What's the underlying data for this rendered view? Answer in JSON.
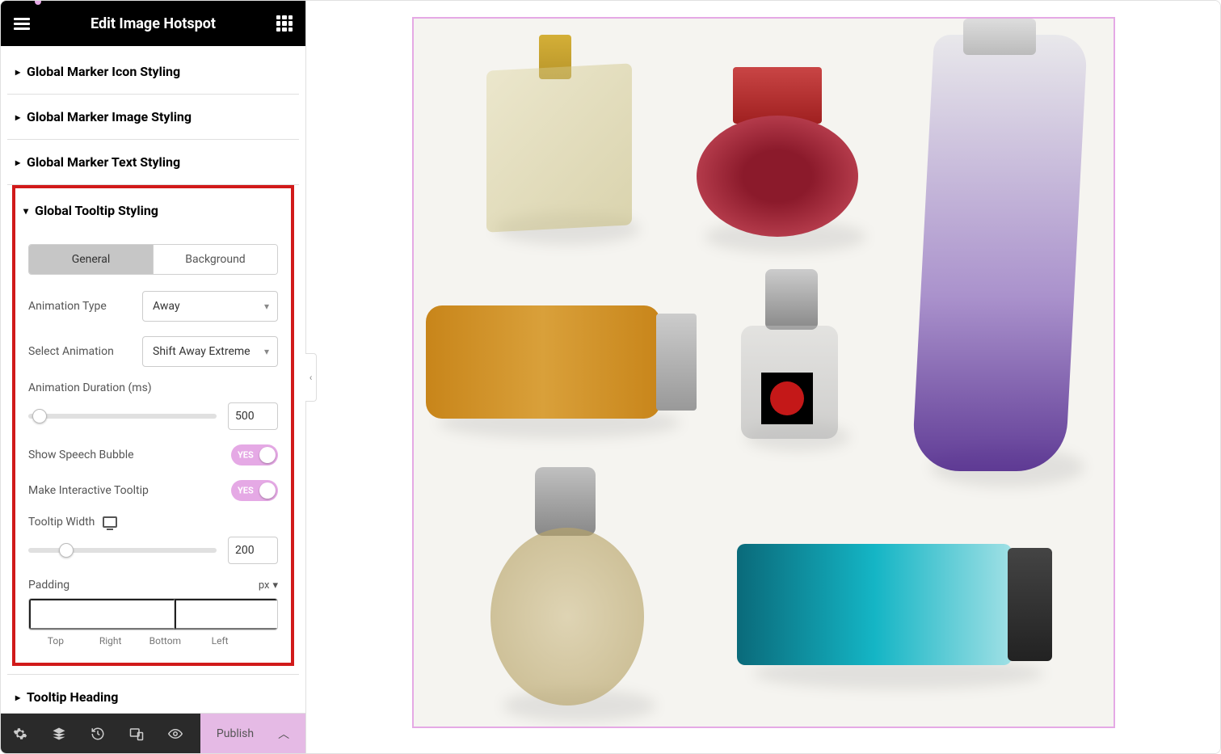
{
  "header": {
    "title": "Edit Image Hotspot"
  },
  "accordion": {
    "icon_styling": "Global Marker Icon Styling",
    "image_styling": "Global Marker Image Styling",
    "text_styling": "Global Marker Text Styling",
    "tooltip_styling": "Global Tooltip Styling",
    "tooltip_heading": "Tooltip Heading"
  },
  "tabs": {
    "general": "General",
    "background": "Background"
  },
  "fields": {
    "animation_type": {
      "label": "Animation Type",
      "value": "Away"
    },
    "select_animation": {
      "label": "Select Animation",
      "value": "Shift Away Extreme"
    },
    "animation_duration": {
      "label": "Animation Duration (ms)",
      "value": "500"
    },
    "show_speech_bubble": {
      "label": "Show Speech Bubble",
      "value": "YES"
    },
    "make_interactive": {
      "label": "Make Interactive Tooltip",
      "value": "YES"
    },
    "tooltip_width": {
      "label": "Tooltip Width",
      "value": "200"
    },
    "padding": {
      "label": "Padding",
      "unit": "px",
      "sides": {
        "top": "Top",
        "right": "Right",
        "bottom": "Bottom",
        "left": "Left"
      }
    }
  },
  "bottom": {
    "publish": "Publish"
  }
}
